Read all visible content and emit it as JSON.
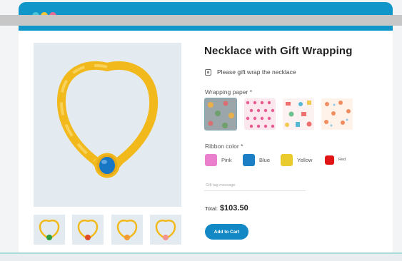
{
  "product": {
    "title": "Necklace with Gift Wrapping",
    "gift_wrap_label": "Please gift wrap the necklace",
    "gift_wrap_checked": true
  },
  "wrapping": {
    "label": "Wrapping paper *",
    "options": [
      {
        "pattern": "grey-botanical",
        "selected": true
      },
      {
        "pattern": "pink-hearts",
        "selected": false
      },
      {
        "pattern": "colorful-confetti",
        "selected": false
      },
      {
        "pattern": "orange-florals",
        "selected": false
      }
    ]
  },
  "ribbon": {
    "label": "Ribbon color *",
    "options": [
      {
        "label": "Pink",
        "color": "#ea7fcd"
      },
      {
        "label": "Blue",
        "color": "#1c7ec5"
      },
      {
        "label": "Yellow",
        "color": "#e9cb2e"
      },
      {
        "label": "Red",
        "color": "#e01414"
      }
    ]
  },
  "message": {
    "placeholder": "Gift tag message",
    "value": ""
  },
  "total": {
    "label": "Total:",
    "value": "$103.50"
  },
  "cart": {
    "button_label": "Add to Cart"
  },
  "thumbnails": [
    {
      "gem": "green",
      "color": "#2f9d42"
    },
    {
      "gem": "red",
      "color": "#e04a2a"
    },
    {
      "gem": "orange",
      "color": "#f29a33"
    },
    {
      "gem": "pink",
      "color": "#f29390"
    }
  ],
  "colors": {
    "brand": "#1196c9",
    "button": "#1288c4",
    "gold": "#f2b91c",
    "main_gem": "#1777c4"
  }
}
